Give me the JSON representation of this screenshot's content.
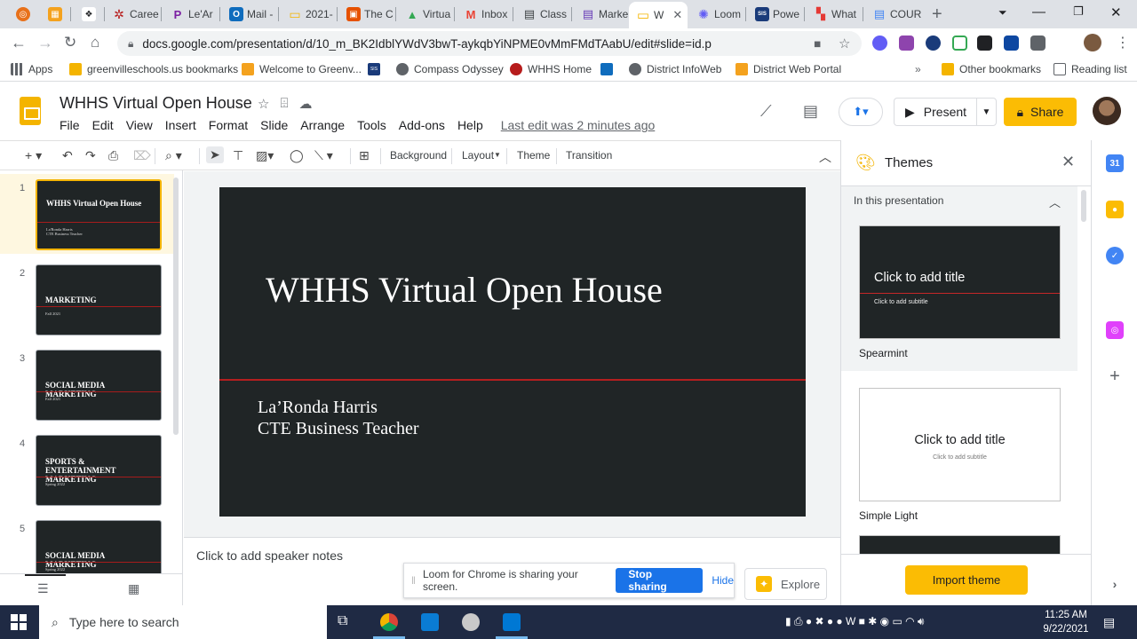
{
  "browser": {
    "tabs": [
      {
        "label": "",
        "color": "#e8711a",
        "glyph": "◎"
      },
      {
        "label": "",
        "color": "#f4a21e",
        "glyph": "▦"
      },
      {
        "label": "",
        "color": "#202124",
        "glyph": "❖"
      },
      {
        "label": "Caree",
        "color": "#b71c1c",
        "glyph": "✲"
      },
      {
        "label": "Le'Ar",
        "color": "#7b1fa2",
        "glyph": "P"
      },
      {
        "label": "Mail -",
        "color": "#0f6cbd",
        "glyph": "O"
      },
      {
        "label": "2021-",
        "color": "#f4b400",
        "glyph": "▭"
      },
      {
        "label": "The C",
        "color": "#e65100",
        "glyph": "▣"
      },
      {
        "label": "Virtua",
        "color": "#34a853",
        "glyph": "▲"
      },
      {
        "label": "Inbox",
        "color": "#ea4335",
        "glyph": "M"
      },
      {
        "label": "Class",
        "color": "#3c4043",
        "glyph": "▤"
      },
      {
        "label": "Marke",
        "color": "#673ab7",
        "glyph": "▤"
      },
      {
        "label": "W",
        "color": "#f4b400",
        "glyph": "▭"
      },
      {
        "label": "Loom",
        "color": "#625df5",
        "glyph": "✺"
      },
      {
        "label": "Powe",
        "color": "#1a3b7a",
        "glyph": "SIS"
      },
      {
        "label": "What",
        "color": "#e53935",
        "glyph": "▚"
      },
      {
        "label": "COUR",
        "color": "#4285f4",
        "glyph": "▤"
      }
    ],
    "url": "docs.google.com/presentation/d/10_m_BK2IdblYWdV3bwT-aykqbYiNPME0vMmFMdTAabU/edit#slide=id.p",
    "bookmarks": [
      {
        "label": "Apps",
        "color": "#5f6368"
      },
      {
        "label": "greenvilleschools.us bookmarks",
        "color": "#f4b400"
      },
      {
        "label": "Welcome to Greenv...",
        "color": "#f4a21e"
      },
      {
        "label": "",
        "color": "#1a3b7a"
      },
      {
        "label": "Compass Odyssey",
        "color": "#5f6368"
      },
      {
        "label": "WHHS Home",
        "color": "#b71c1c"
      },
      {
        "label": "",
        "color": "#0f6cbd"
      },
      {
        "label": "District InfoWeb",
        "color": "#5f6368"
      },
      {
        "label": "District Web Portal",
        "color": "#f4a21e"
      }
    ],
    "other_bookmarks": "Other bookmarks",
    "reading_list": "Reading list",
    "sis_glyph": "SIS"
  },
  "app": {
    "title": "WHHS Virtual Open House",
    "menus": [
      "File",
      "Edit",
      "View",
      "Insert",
      "Format",
      "Slide",
      "Arrange",
      "Tools",
      "Add-ons",
      "Help"
    ],
    "last_edit": "Last edit was 2 minutes ago",
    "present_label": "Present",
    "share_label": "Share"
  },
  "toolbar": {
    "background": "Background",
    "layout": "Layout",
    "theme": "Theme",
    "transition": "Transition"
  },
  "slides": [
    {
      "num": "1",
      "title": "WHHS Virtual Open House",
      "sub": "La'Ronda Harris\nCTE Business Teacher"
    },
    {
      "num": "2",
      "title": "MARKETING",
      "sub": "Fall 2021"
    },
    {
      "num": "3",
      "title": "SOCIAL MEDIA MARKETING",
      "sub": "Fall 2021"
    },
    {
      "num": "4",
      "title": "SPORTS & ENTERTAINMENT MARKETING",
      "sub": "Spring 2022"
    },
    {
      "num": "5",
      "title": "SOCIAL MEDIA MARKETING",
      "sub": "Spring 2022"
    }
  ],
  "current_slide": {
    "title": "WHHS Virtual Open House",
    "subtitle_line1": "La’Ronda Harris",
    "subtitle_line2": "CTE Business Teacher"
  },
  "notes_placeholder": "Click to add speaker notes",
  "loom": {
    "message": "Loom for Chrome is sharing your screen.",
    "stop": "Stop sharing",
    "hide": "Hide"
  },
  "explore_label": "Explore",
  "themes_panel": {
    "title": "Themes",
    "section": "In this presentation",
    "themes": [
      {
        "name": "Spearmint",
        "card_title": "Click to add title",
        "card_sub": "Click to add subtitle"
      },
      {
        "name": "Simple Light",
        "card_title": "Click to add title",
        "card_sub": "Click to add subtitle"
      }
    ],
    "import_label": "Import theme"
  },
  "taskbar": {
    "search_placeholder": "Type here to search",
    "time": "11:25 AM",
    "date": "9/22/2021"
  },
  "colors": {
    "accent": "#fbbc04",
    "slide_bg": "#202526",
    "slide_rule": "#b41f1f",
    "link_blue": "#1a73e8"
  }
}
